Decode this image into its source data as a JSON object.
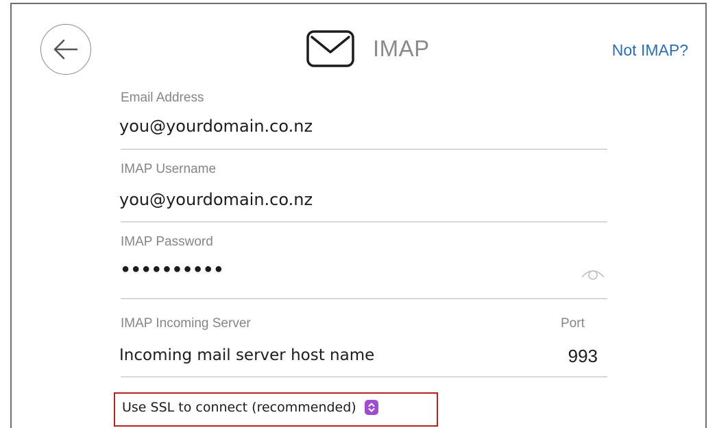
{
  "header": {
    "title": "IMAP",
    "not_imap_label": "Not IMAP?",
    "icons": {
      "back": "back-arrow-icon",
      "mail": "mail-envelope-icon"
    }
  },
  "form": {
    "email": {
      "label": "Email Address",
      "value": "you@yourdomain.co.nz"
    },
    "username": {
      "label": "IMAP Username",
      "value": "you@yourdomain.co.nz"
    },
    "password": {
      "label": "IMAP Password",
      "masked": "●●●●●●●●●●",
      "reveal_icon": "eye-icon"
    },
    "incoming_server": {
      "label": "IMAP Incoming Server",
      "value": "Incoming mail server host name"
    },
    "port": {
      "label": "Port",
      "value": "993"
    },
    "ssl": {
      "selected": "Use SSL to connect (recommended)",
      "selector_icon": "up-down-chevron-icon"
    }
  },
  "colors": {
    "link": "#2a6fb3",
    "label": "#858585",
    "highlight": "#b22222",
    "selector": "#a14ccf"
  }
}
